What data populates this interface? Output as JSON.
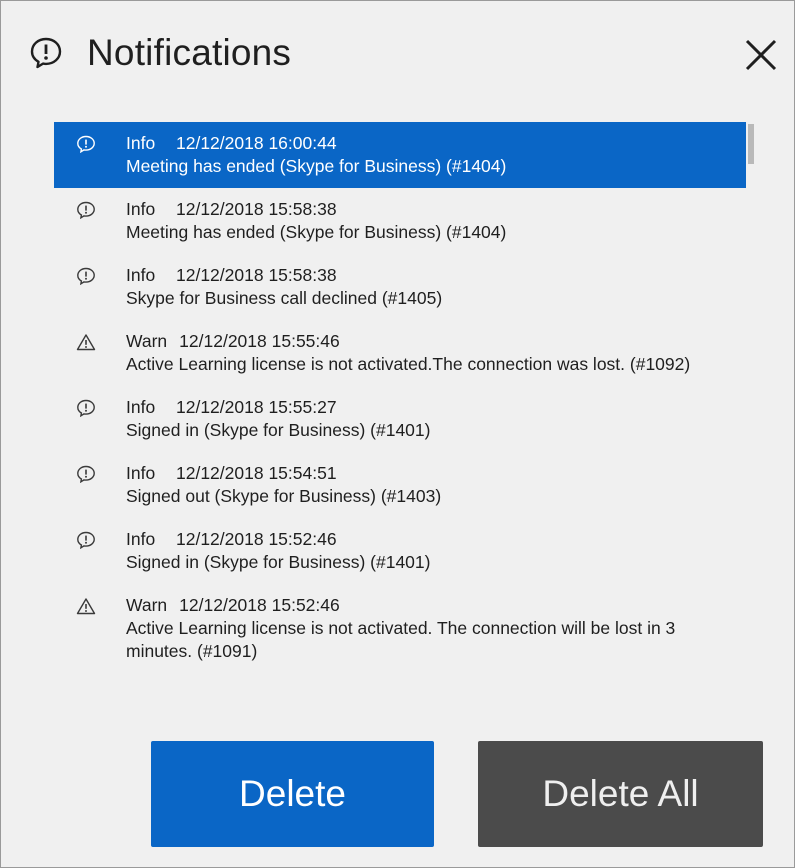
{
  "dialog": {
    "title": "Notifications",
    "title_icon": "info-speech-icon",
    "close_icon": "close-icon"
  },
  "notifications": [
    {
      "level": "Info",
      "timestamp": "12/12/2018 16:00:44",
      "message": "Meeting has ended (Skype for Business) (#1404)",
      "icon": "info-icon",
      "selected": true
    },
    {
      "level": "Info",
      "timestamp": "12/12/2018 15:58:38",
      "message": "Meeting has ended (Skype for Business) (#1404)",
      "icon": "info-icon",
      "selected": false
    },
    {
      "level": "Info",
      "timestamp": "12/12/2018 15:58:38",
      "message": "Skype for Business call declined (#1405)",
      "icon": "info-icon",
      "selected": false
    },
    {
      "level": "Warn",
      "timestamp": "12/12/2018 15:55:46",
      "message": "Active Learning license is not activated.The connection was lost. (#1092)",
      "icon": "warning-icon",
      "selected": false
    },
    {
      "level": "Info",
      "timestamp": "12/12/2018 15:55:27",
      "message": "Signed in (Skype for Business) (#1401)",
      "icon": "info-icon",
      "selected": false
    },
    {
      "level": "Info",
      "timestamp": "12/12/2018 15:54:51",
      "message": "Signed out (Skype for Business) (#1403)",
      "icon": "info-icon",
      "selected": false
    },
    {
      "level": "Info",
      "timestamp": "12/12/2018 15:52:46",
      "message": "Signed in (Skype for Business) (#1401)",
      "icon": "info-icon",
      "selected": false
    },
    {
      "level": "Warn",
      "timestamp": "12/12/2018 15:52:46",
      "message": "Active Learning license is not activated. The connection will be lost in 3 minutes. (#1091)",
      "icon": "warning-icon",
      "selected": false
    }
  ],
  "buttons": {
    "delete_label": "Delete",
    "delete_all_label": "Delete All"
  },
  "colors": {
    "accent": "#0a66c6",
    "secondary_button": "#4b4b4b",
    "background": "#f0f0f0"
  }
}
